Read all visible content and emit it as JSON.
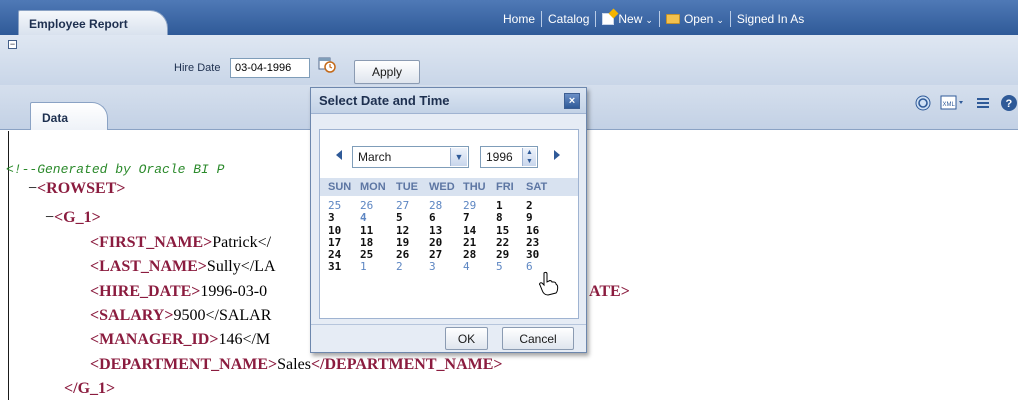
{
  "header": {
    "tab_title": "Employee Report",
    "nav": {
      "home": "Home",
      "catalog": "Catalog",
      "new": "New",
      "open": "Open",
      "signed_in": "Signed In As"
    }
  },
  "params": {
    "hire_date_label": "Hire Date",
    "hire_date_value": "03-04-1996",
    "apply_label": "Apply"
  },
  "tabs": {
    "data": "Data"
  },
  "xml": {
    "comment": "<!--Generated by Oracle BI P",
    "rowset_open": "<ROWSET>",
    "g1_open": "<G_1>",
    "first_name_tag": "<FIRST_NAME>",
    "first_name_val": "Patrick</",
    "last_name_tag": "<LAST_NAME>",
    "last_name_val": "Sully</LA",
    "hire_date_tag": "<HIRE_DATE>",
    "hire_date_val": "1996-03-0",
    "hire_date_tail": "ATE>",
    "salary_tag": "<SALARY>",
    "salary_val": "9500</SALAR",
    "manager_tag": "<MANAGER_ID>",
    "manager_val": "146</M",
    "dept_tag_open": "<DEPARTMENT_NAME>",
    "dept_val": "Sales",
    "dept_tag_close": "</DEPARTMENT_NAME>",
    "g1_close": "</G_1>",
    "toggle": "−"
  },
  "dialog": {
    "title": "Select Date and Time",
    "close": "×",
    "month": "March",
    "year": "1996",
    "weekdays": [
      "SUN",
      "MON",
      "TUE",
      "WED",
      "THU",
      "FRI",
      "SAT"
    ],
    "weeks": [
      [
        "25",
        "26",
        "27",
        "28",
        "29",
        "1",
        "2"
      ],
      [
        "3",
        "4",
        "5",
        "6",
        "7",
        "8",
        "9"
      ],
      [
        "10",
        "11",
        "12",
        "13",
        "14",
        "15",
        "16"
      ],
      [
        "17",
        "18",
        "19",
        "20",
        "21",
        "22",
        "23"
      ],
      [
        "24",
        "25",
        "26",
        "27",
        "28",
        "29",
        "30"
      ],
      [
        "31",
        "1",
        "2",
        "3",
        "4",
        "5",
        "6"
      ]
    ],
    "other_month_days": [
      [
        0,
        0
      ],
      [
        0,
        1
      ],
      [
        0,
        2
      ],
      [
        0,
        3
      ],
      [
        0,
        4
      ],
      [
        5,
        1
      ],
      [
        5,
        2
      ],
      [
        5,
        3
      ],
      [
        5,
        4
      ],
      [
        5,
        5
      ],
      [
        5,
        6
      ]
    ],
    "selected_day": [
      1,
      1
    ],
    "ok": "OK",
    "cancel": "Cancel"
  }
}
